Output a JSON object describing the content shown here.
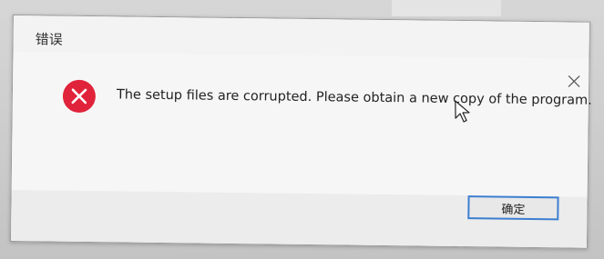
{
  "dialog": {
    "title": "错误",
    "message": "The setup files are corrupted. Please obtain a new copy of the program.",
    "ok_label": "确定",
    "close_glyph": "×",
    "icon": "error-icon",
    "icon_color": "#e0233a",
    "button_border_color": "#3c7fd1"
  }
}
